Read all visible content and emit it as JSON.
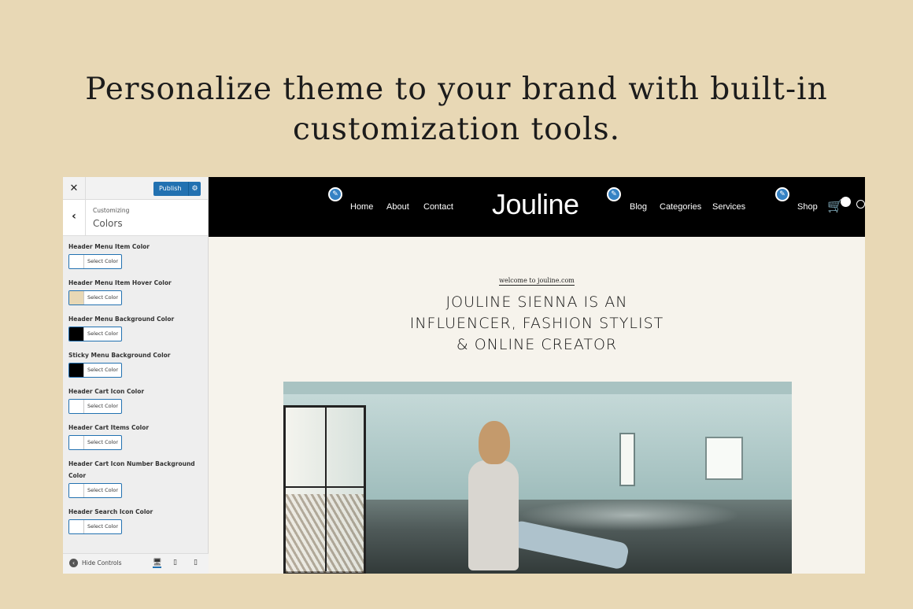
{
  "headline": {
    "line1": "Personalize theme to your brand with built-in",
    "line2": "customization tools."
  },
  "customizer": {
    "close_label": "✕",
    "publish_label": "Publish",
    "gear_icon": "gear-icon",
    "back_label": "‹",
    "breadcrumb": "Customizing",
    "section_title": "Colors",
    "select_color_label": "Select Color",
    "controls": [
      {
        "label": "Header Menu Item Color",
        "swatch": "#ffffff"
      },
      {
        "label": "Header Menu Item Hover Color",
        "swatch": "#e8d8b5"
      },
      {
        "label": "Header Menu Background Color",
        "swatch": "#000000"
      },
      {
        "label": "Sticky Menu Background Color",
        "swatch": "#000000"
      },
      {
        "label": "Header Cart Icon Color",
        "swatch": "#ffffff"
      },
      {
        "label": "Header Cart Items Color",
        "swatch": "#ffffff"
      },
      {
        "label": "Header Cart Icon Number Background Color",
        "swatch": "#ffffff"
      },
      {
        "label": "Header Search Icon Color",
        "swatch": "#ffffff"
      }
    ],
    "hide_controls_label": "Hide Controls"
  },
  "site": {
    "nav_left": [
      "Home",
      "About",
      "Contact"
    ],
    "logo": "Jouline",
    "nav_right": [
      "Blog",
      "Categories",
      "Services"
    ],
    "shop_label": "Shop",
    "tagline": "welcome to jouline.com",
    "hero_line1": "JOULINE SIENNA IS AN",
    "hero_line2": "INFLUENCER, FASHION STYLIST",
    "hero_line3": "& ONLINE CREATOR"
  },
  "colors": {
    "background": "#e8d8b5",
    "accent_blue": "#2271b1",
    "header_black": "#000000"
  }
}
